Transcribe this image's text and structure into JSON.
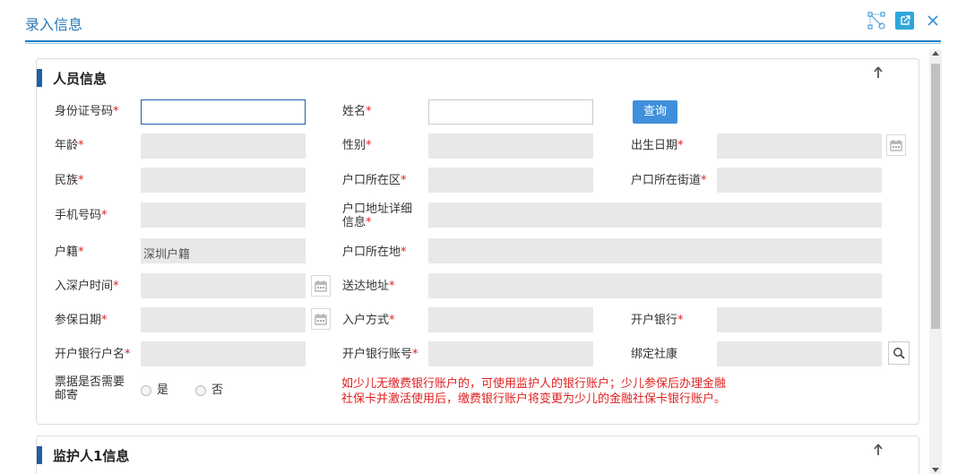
{
  "dialog": {
    "title": "录入信息"
  },
  "section1": {
    "title": "人员信息",
    "fields": {
      "id_number": "身份证号码",
      "name": "姓名",
      "age": "年龄",
      "gender": "性别",
      "birth_date": "出生日期",
      "ethnicity": "民族",
      "hukou_district": "户口所在区",
      "hukou_street": "户口所在街道",
      "mobile": "手机号码",
      "hukou_address_line1": "户口地址详细",
      "hukou_address_line2": "信息",
      "huji": "户籍",
      "hukou_location": "户口所在地",
      "settle_time": "入深户时间",
      "delivery_address": "送达地址",
      "insured_date": "参保日期",
      "hukou_method": "入户方式",
      "bank": "开户银行",
      "account_name": "开户银行户名",
      "account_number": "开户银行账号",
      "bind_card": "绑定社康",
      "receipt_mail_line1": "票据是否需要",
      "receipt_mail_line2": "邮寄"
    },
    "values": {
      "huji": "深圳户籍"
    },
    "query_button": "查询",
    "radio_yes": "是",
    "radio_no": "否",
    "notice_line1": "如少儿无缴费银行账户的，可使用监护人的银行账户；少儿参保后办理金融",
    "notice_line2": "社保卡并激活使用后，缴费银行账户将变更为少儿的金融社保卡银行账户。"
  },
  "section2": {
    "title": "监护人1信息"
  },
  "required_mark": "*",
  "icons": {
    "expand": "expand-icon",
    "popout": "popout-icon",
    "close": "close-icon",
    "calendar": "calendar-icon",
    "search": "search-icon",
    "collapse": "arrow-up-icon"
  },
  "colors": {
    "accent": "#1f5fa8",
    "title": "#2a7ab8",
    "required": "#e02020",
    "button": "#3f8fdc"
  }
}
